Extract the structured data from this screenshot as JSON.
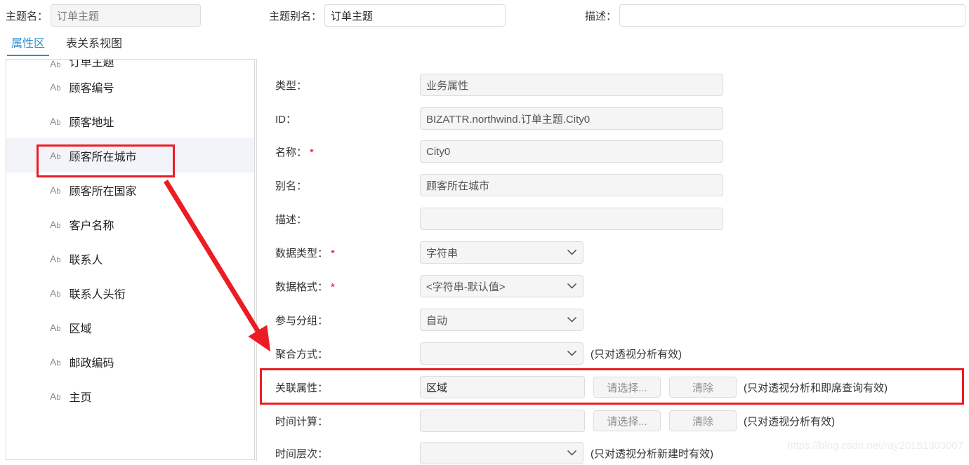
{
  "header": {
    "fields": [
      {
        "label": "主题名：",
        "value": "订单主题",
        "readonly": true
      },
      {
        "label": "主题别名：",
        "value": "订单主题",
        "readonly": false
      },
      {
        "label": "描述：",
        "value": "",
        "readonly": false
      }
    ]
  },
  "tabs": [
    {
      "label": "属性区",
      "active": true
    },
    {
      "label": "表关系视图",
      "active": false
    }
  ],
  "sidebar": {
    "items": [
      {
        "label": "订单主题",
        "icon": "ab-icon",
        "clipped": true,
        "selected": false
      },
      {
        "label": "顾客编号",
        "icon": "ab-icon",
        "clipped": false,
        "selected": false
      },
      {
        "label": "顾客地址",
        "icon": "ab-icon",
        "clipped": false,
        "selected": false
      },
      {
        "label": "顾客所在城市",
        "icon": "ab-icon",
        "clipped": false,
        "selected": true
      },
      {
        "label": "顾客所在国家",
        "icon": "ab-icon",
        "clipped": false,
        "selected": false
      },
      {
        "label": "客户名称",
        "icon": "ab-icon",
        "clipped": false,
        "selected": false
      },
      {
        "label": "联系人",
        "icon": "ab-icon",
        "clipped": false,
        "selected": false
      },
      {
        "label": "联系人头衔",
        "icon": "ab-icon",
        "clipped": false,
        "selected": false
      },
      {
        "label": "区域",
        "icon": "ab-icon",
        "clipped": false,
        "selected": false
      },
      {
        "label": "邮政编码",
        "icon": "ab-icon",
        "clipped": false,
        "selected": false
      },
      {
        "label": "主页",
        "icon": "ab-icon",
        "clipped": false,
        "selected": false
      }
    ]
  },
  "form": {
    "type": {
      "label": "类型：",
      "value": "业务属性"
    },
    "id": {
      "label": "ID：",
      "value": "BIZATTR.northwind.订单主题.City0"
    },
    "name": {
      "label": "名称：",
      "required": "*",
      "value": "City0"
    },
    "alias": {
      "label": "别名：",
      "value": "顾客所在城市"
    },
    "desc": {
      "label": "描述：",
      "value": ""
    },
    "dtype": {
      "label": "数据类型：",
      "required": "*",
      "value": "字符串"
    },
    "dformat": {
      "label": "数据格式：",
      "required": "*",
      "value": "<字符串-默认值>"
    },
    "group": {
      "label": "参与分组：",
      "value": "自动"
    },
    "agg": {
      "label": "聚合方式：",
      "value": "",
      "note": "(只对透视分析有效)"
    },
    "assoc": {
      "label": "关联属性：",
      "value": "区域",
      "note": "(只对透视分析和即席查询有效)",
      "select_btn": "请选择...",
      "clear_btn": "清除"
    },
    "timecalc": {
      "label": "时间计算：",
      "value": "",
      "note": "(只对透视分析有效)",
      "select_btn": "请选择...",
      "clear_btn": "清除"
    },
    "timelevel": {
      "label": "时间层次：",
      "value": "",
      "note": "(只对透视分析新建时有效)"
    }
  },
  "watermark": {
    "text": "https://blog.csdn.net/ray20151303007"
  },
  "colors": {
    "accent": "#2a8fd0",
    "annotation": "#ec1c24",
    "required": "#e60012",
    "field_bg": "#f5f5f5",
    "selected_row": "#f2f4f9"
  }
}
